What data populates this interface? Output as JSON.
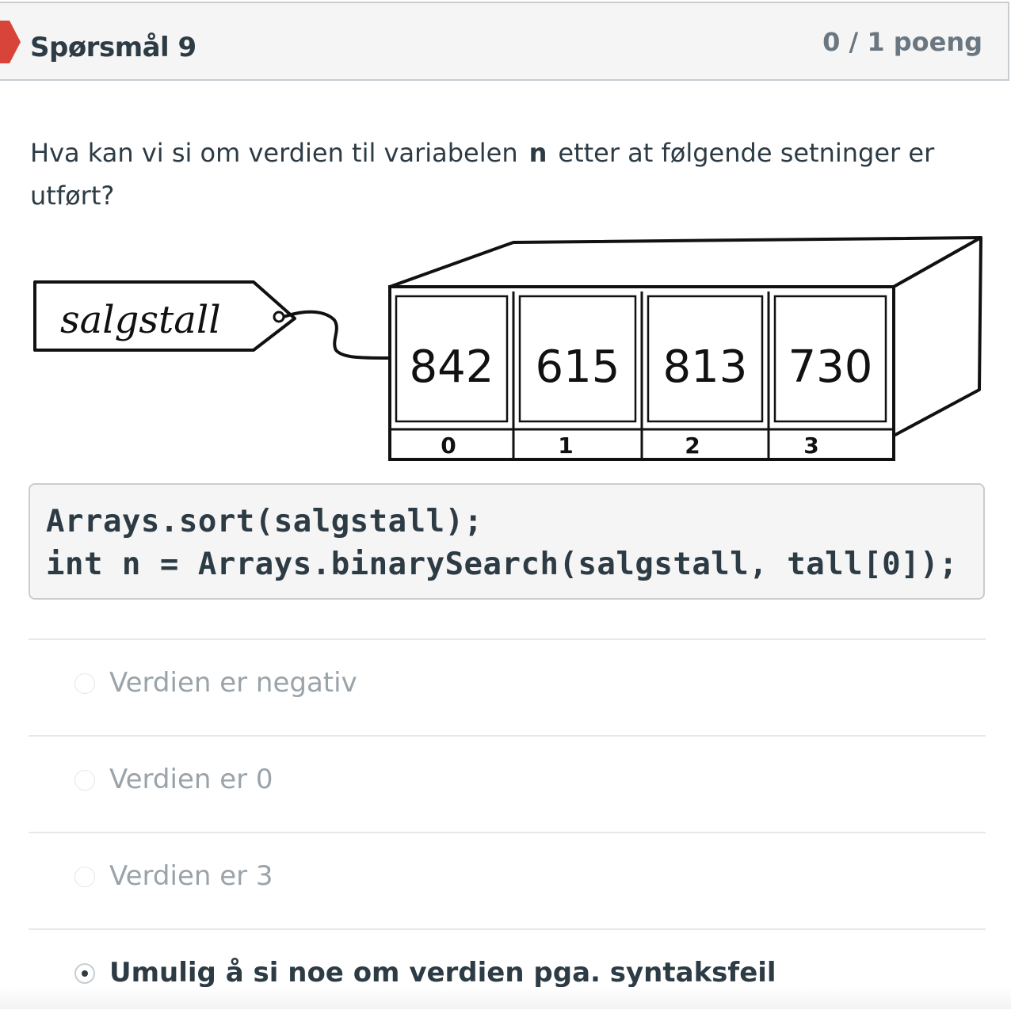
{
  "question": {
    "title": "Spørsmål 9",
    "points": "0 / 1 poeng",
    "text_before": "Hva kan vi si om verdien til variabelen",
    "variable": "n",
    "text_after": "etter at følgende setninger er utført?"
  },
  "diagram": {
    "tag_label": "salgstall",
    "cells": [
      {
        "index": "0",
        "value": "842"
      },
      {
        "index": "1",
        "value": "615"
      },
      {
        "index": "2",
        "value": "813"
      },
      {
        "index": "3",
        "value": "730"
      }
    ]
  },
  "code": {
    "line1": "Arrays.sort(salgstall);",
    "line2": "int n = Arrays.binarySearch(salgstall, tall[0]);"
  },
  "answers": [
    {
      "label": "Verdien er negativ",
      "selected": false
    },
    {
      "label": "Verdien er 0",
      "selected": false
    },
    {
      "label": "Verdien er 3",
      "selected": false
    },
    {
      "label": "Umulig å si noe om verdien pga. syntaksfeil",
      "selected": true
    }
  ],
  "colors": {
    "flag": "#d9443a",
    "text": "#2d3b45",
    "muted": "#9aa3a9",
    "header_bg": "#f5f5f5"
  }
}
